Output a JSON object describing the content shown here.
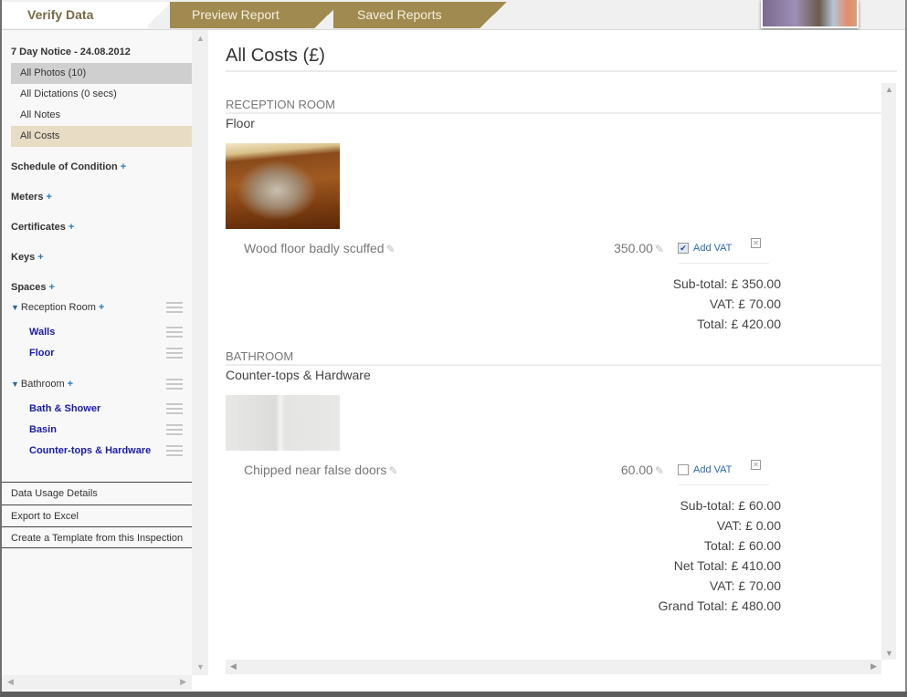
{
  "tabs": [
    {
      "label": "Verify Data",
      "active": true
    },
    {
      "label": "Preview Report",
      "active": false
    },
    {
      "label": "Saved Reports",
      "active": false
    }
  ],
  "sidebar": {
    "title": "7 Day Notice - 24.08.2012",
    "filters": [
      {
        "label": "All Photos (10)",
        "state": "hover"
      },
      {
        "label": "All Dictations (0 secs)",
        "state": "normal"
      },
      {
        "label": "All Notes",
        "state": "normal"
      },
      {
        "label": "All Costs",
        "state": "selected"
      }
    ],
    "sections": [
      {
        "label": "Schedule of Condition",
        "add": "+"
      },
      {
        "label": "Meters",
        "add": "+"
      },
      {
        "label": "Certificates",
        "add": "+"
      },
      {
        "label": "Keys",
        "add": "+"
      },
      {
        "label": "Spaces",
        "add": "+"
      }
    ],
    "rooms": [
      {
        "label": "Reception Room",
        "add": "+",
        "spaces": [
          "Walls",
          "Floor"
        ]
      },
      {
        "label": "Bathroom",
        "add": "+",
        "spaces": [
          "Bath & Shower",
          "Basin",
          "Counter-tops & Hardware"
        ]
      }
    ],
    "links": [
      "Data Usage Details",
      "Export to Excel",
      "Create a Template from this Inspection"
    ]
  },
  "main": {
    "title": "All Costs (£)",
    "groups": [
      {
        "room": "RECEPTION ROOM",
        "space": "Floor",
        "photo": "wood-floor-photo",
        "item": {
          "description": "Wood floor badly scuffed",
          "amount": "350.00",
          "add_vat": true,
          "vat_label": "Add VAT"
        },
        "totals": {
          "subtotal": "Sub-total: £ 350.00",
          "vat": "VAT: £ 70.00",
          "total": "Total: £ 420.00"
        }
      },
      {
        "room": "BATHROOM",
        "space": "Counter-tops & Hardware",
        "photo": "counter-doors-photo",
        "item": {
          "description": "Chipped near false doors",
          "amount": "60.00",
          "add_vat": false,
          "vat_label": "Add VAT"
        },
        "totals": {
          "subtotal": "Sub-total: £ 60.00",
          "vat": "VAT: £ 0.00",
          "total": "Total: £ 60.00"
        }
      }
    ],
    "summary": {
      "net_total": "Net Total: £ 410.00",
      "vat": "VAT: £ 70.00",
      "grand_total": "Grand Total: £ 480.00"
    }
  },
  "icons": {
    "pencil": "✎",
    "check": "✔",
    "delete": "✕",
    "triangle_down": "▼",
    "arrow_up": "▲",
    "arrow_down": "▼",
    "arrow_left": "◀",
    "arrow_right": "▶"
  }
}
